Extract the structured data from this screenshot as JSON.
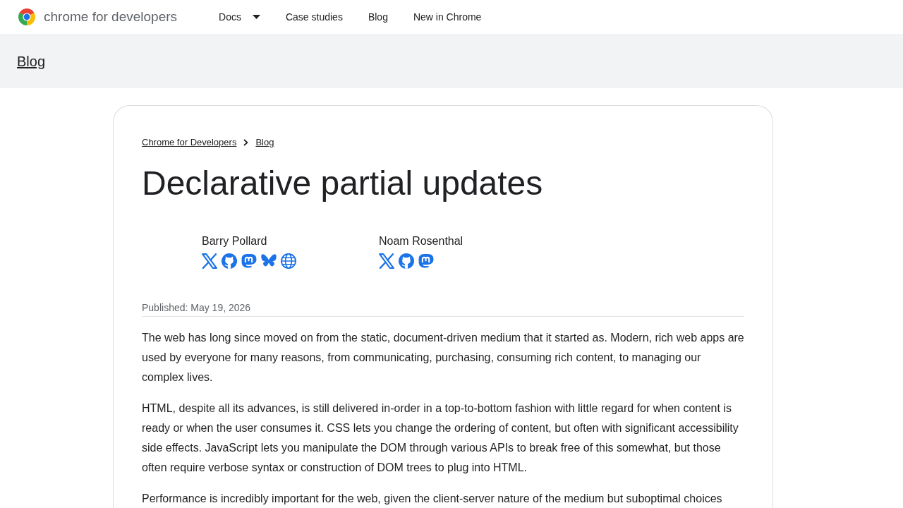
{
  "header": {
    "logo_text": "chrome for developers",
    "nav": [
      {
        "label": "Docs",
        "kind": "dropdown"
      },
      {
        "label": "Case studies",
        "kind": "link"
      },
      {
        "label": "Blog",
        "kind": "link"
      },
      {
        "label": "New in Chrome",
        "kind": "link"
      }
    ]
  },
  "section_bar": {
    "title": "Blog"
  },
  "article": {
    "breadcrumbs": [
      "Chrome for Developers",
      "Blog"
    ],
    "title": "Declarative partial updates",
    "authors": [
      {
        "name": "Barry Pollard",
        "links": [
          {
            "kind": "x"
          },
          {
            "kind": "github"
          },
          {
            "kind": "mastodon"
          },
          {
            "kind": "bluesky"
          },
          {
            "kind": "website"
          }
        ]
      },
      {
        "name": "Noam Rosenthal",
        "links": [
          {
            "kind": "x"
          },
          {
            "kind": "github"
          },
          {
            "kind": "mastodon"
          }
        ]
      }
    ],
    "published": "Published: May 19, 2026",
    "paragraphs": [
      "The web has long since moved on from the static, document-driven medium that it started as. Modern, rich web apps are used by everyone for many reasons, from communicating, purchasing, consuming rich content, to managing our complex lives.",
      "HTML, despite all its advances, is still delivered in-order in a top-to-bottom fashion with little regard for when content is ready or when the user consumes it. CSS lets you change the ordering of content, but often with significant accessibility side effects. JavaScript lets you manipulate the DOM through various APIs to break free of this somewhat, but those often require verbose syntax or construction of DOM trees to plug into HTML.",
      "Performance is incredibly important for the web, given the client-server nature of the medium but suboptimal choices"
    ]
  }
}
